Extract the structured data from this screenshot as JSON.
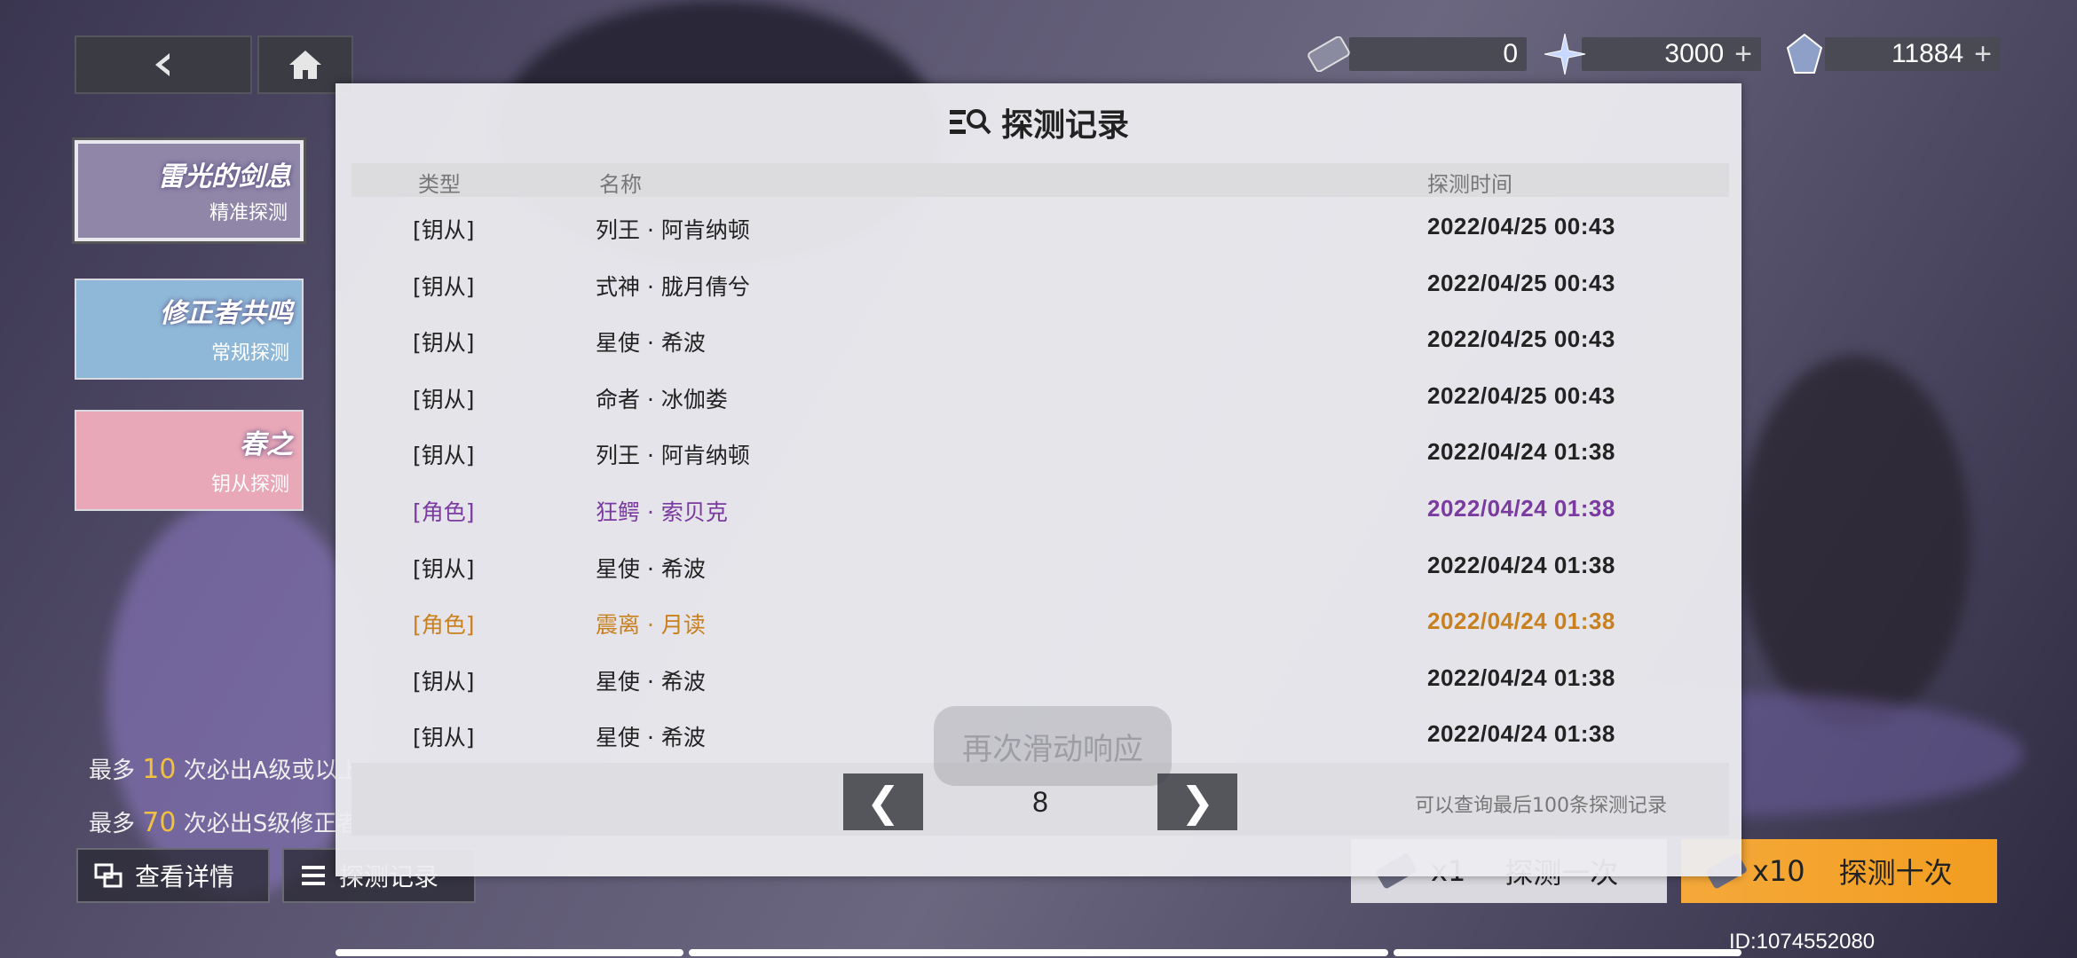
{
  "currencies": [
    {
      "icon": "ticket-icon",
      "value": "0",
      "plus": ""
    },
    {
      "icon": "star-crystal-icon",
      "value": "3000",
      "plus": "+"
    },
    {
      "icon": "gem-icon",
      "value": "11884",
      "plus": "+"
    }
  ],
  "banners": [
    {
      "title": "雷光的剑息",
      "subtitle": "精准探测"
    },
    {
      "title": "修正者共鸣",
      "subtitle": "常规探测"
    },
    {
      "title": "春之",
      "subtitle": "钥从探测"
    }
  ],
  "info": {
    "line1_prefix": "最多",
    "line1_num": "10",
    "line1_suffix": "次必出A级或以上",
    "line2_prefix": "最多",
    "line2_num": "70",
    "line2_suffix": "次必出S级修正者"
  },
  "buttons": {
    "details": "查看详情",
    "records": "探测记录",
    "draw1_count": "x1",
    "draw1_label": "探测一次",
    "draw10_count": "x10",
    "draw10_label": "探测十次"
  },
  "uid": "ID:1074552080",
  "modal": {
    "title": "探测记录",
    "headers": {
      "type": "类型",
      "name": "名称",
      "time": "探测时间"
    },
    "rows": [
      {
        "type": "[钥从]",
        "name": "列王 · 阿肯纳顿",
        "time": "2022/04/25 00:43",
        "rarity": "normal"
      },
      {
        "type": "[钥从]",
        "name": "式神 · 胧月倩兮",
        "time": "2022/04/25 00:43",
        "rarity": "normal"
      },
      {
        "type": "[钥从]",
        "name": "星使 · 希波",
        "time": "2022/04/25 00:43",
        "rarity": "normal"
      },
      {
        "type": "[钥从]",
        "name": "命者 · 冰伽娄",
        "time": "2022/04/25 00:43",
        "rarity": "normal"
      },
      {
        "type": "[钥从]",
        "name": "列王 · 阿肯纳顿",
        "time": "2022/04/24 01:38",
        "rarity": "normal"
      },
      {
        "type": "[角色]",
        "name": "狂鳄 · 索贝克",
        "time": "2022/04/24 01:38",
        "rarity": "purple"
      },
      {
        "type": "[钥从]",
        "name": "星使 · 希波",
        "time": "2022/04/24 01:38",
        "rarity": "normal"
      },
      {
        "type": "[角色]",
        "name": "震离 · 月读",
        "time": "2022/04/24 01:38",
        "rarity": "orange"
      },
      {
        "type": "[钥从]",
        "name": "星使 · 希波",
        "time": "2022/04/24 01:38",
        "rarity": "normal"
      },
      {
        "type": "[钥从]",
        "name": "星使 · 希波",
        "time": "2022/04/24 01:38",
        "rarity": "normal"
      }
    ],
    "page": "8",
    "prev": "❮",
    "next": "❯",
    "note": "可以查询最后100条探测记录"
  },
  "toast": "再次滑动响应",
  "colors": {
    "purple": "#7a3aa0",
    "orange": "#c9801e",
    "accent": "#f29d20"
  }
}
